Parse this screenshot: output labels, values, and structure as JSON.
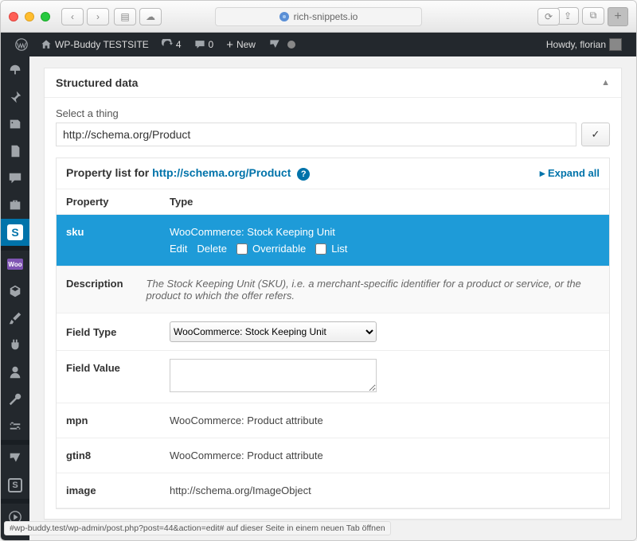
{
  "browser": {
    "url_host": "rich-snippets.io",
    "status_text": "#wp-buddy.test/wp-admin/post.php?post=44&action=edit# auf dieser Seite in einem neuen Tab öffnen"
  },
  "adminbar": {
    "site_name": "WP-Buddy TESTSITE",
    "updates_count": "4",
    "comments_count": "0",
    "new_label": "New",
    "howdy": "Howdy, florian"
  },
  "postbox": {
    "title": "Structured data",
    "select_thing_label": "Select a thing",
    "thing_value": "http://schema.org/Product",
    "check_icon": "✓",
    "collapse_caret": "▲"
  },
  "property_list": {
    "header_prefix": "Property list for ",
    "header_link": "http://schema.org/Product",
    "expand_all": "Expand all",
    "col_property": "Property",
    "col_type": "Type",
    "active": {
      "property": "sku",
      "type_label": "WooCommerce: Stock Keeping Unit",
      "action_edit": "Edit",
      "action_delete": "Delete",
      "chk_overridable": "Overridable",
      "chk_list": "List"
    },
    "description": {
      "label": "Description",
      "text": "The Stock Keeping Unit (SKU), i.e. a merchant-specific identifier for a product or service, or the product to which the offer refers."
    },
    "field_type": {
      "label": "Field Type",
      "selected": "WooCommerce: Stock Keeping Unit"
    },
    "field_value": {
      "label": "Field Value",
      "value": ""
    },
    "rows": [
      {
        "property": "mpn",
        "type": "WooCommerce: Product attribute"
      },
      {
        "property": "gtin8",
        "type": "WooCommerce: Product attribute"
      },
      {
        "property": "image",
        "type": "http://schema.org/ImageObject"
      }
    ]
  },
  "sidebar_items": [
    "dashboard-icon",
    "pin-icon",
    "media-icon",
    "pages-icon",
    "comments-icon",
    "briefcase-icon",
    "active-s-icon",
    "sep",
    "woo-icon",
    "cube-icon",
    "brush-icon",
    "plugins-icon",
    "users-icon",
    "tools-icon",
    "settings-icon",
    "sep",
    "y-icon",
    "s2-icon",
    "sep",
    "play-icon"
  ]
}
